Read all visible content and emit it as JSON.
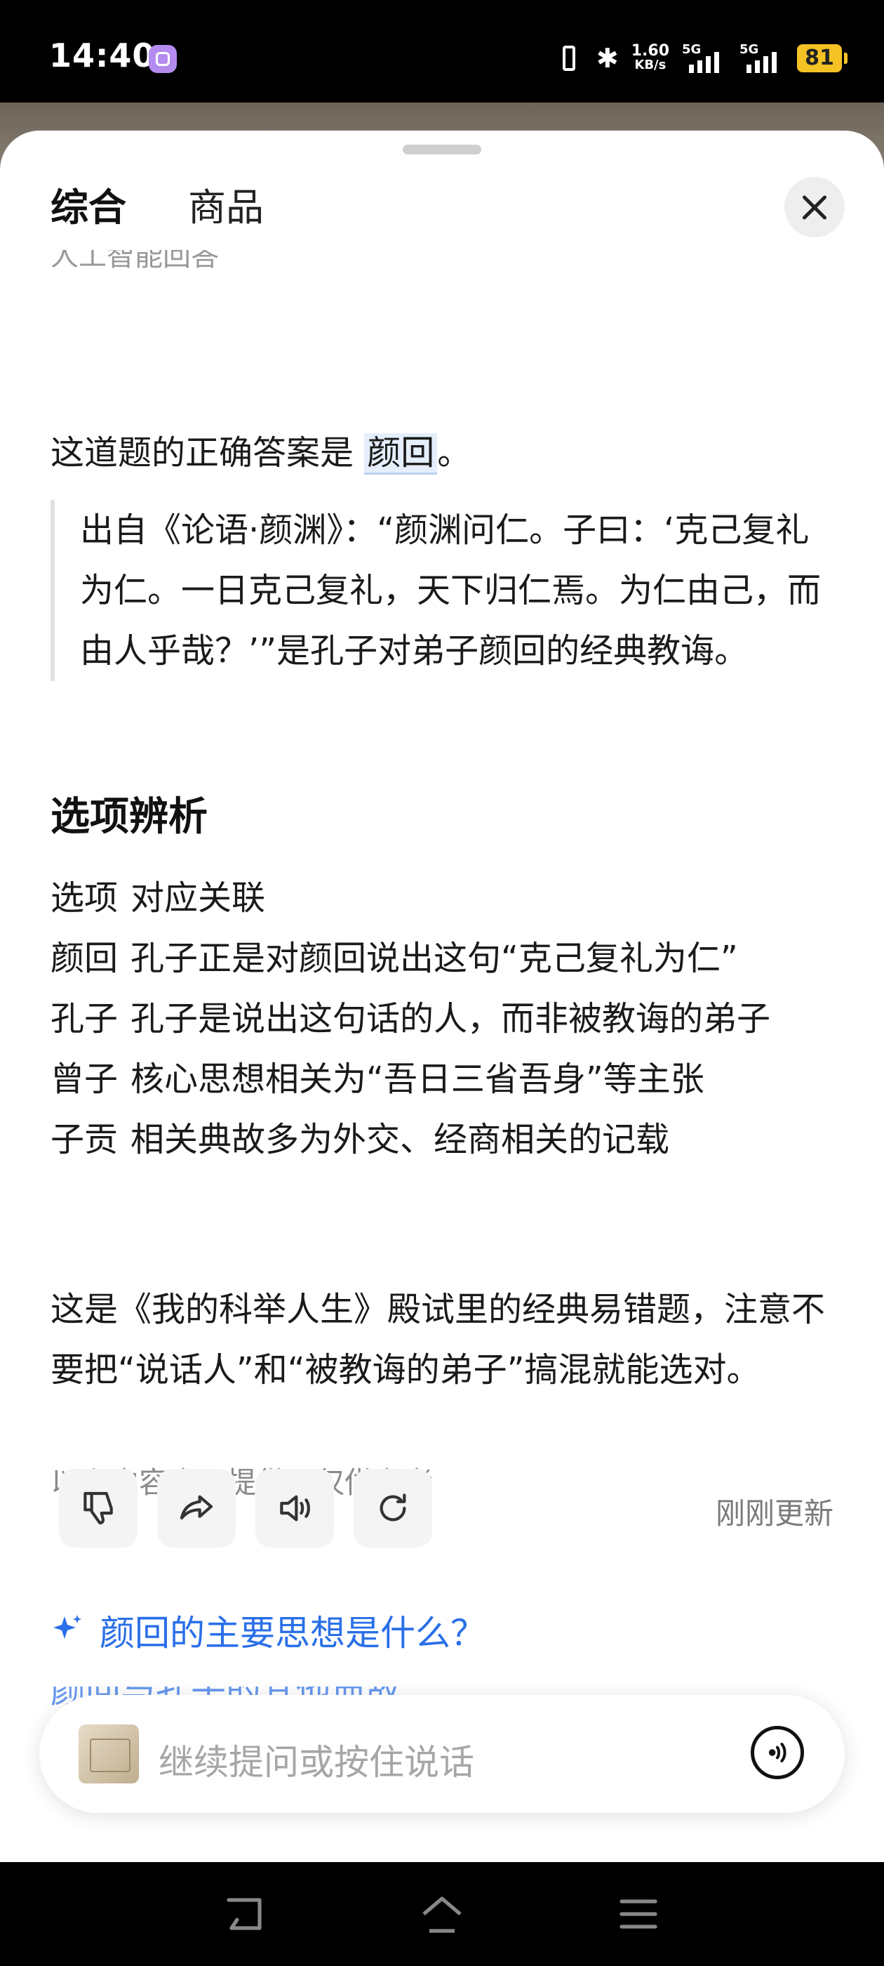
{
  "status_bar": {
    "time": "14:40",
    "net_speed_value": "1.60",
    "net_speed_unit": "KB/s",
    "signal1_label": "5G",
    "signal2_label": "5G",
    "battery": "81"
  },
  "tabs": [
    {
      "label": "综合",
      "active": true
    },
    {
      "label": "商品",
      "active": false
    }
  ],
  "clipped_line": "人工智能回答",
  "answer": {
    "prefix": "这道题的正确答案是 ",
    "highlight": "颜回",
    "suffix": "。"
  },
  "quote": "出自《论语·颜渊》：“颜渊问仁。子曰：‘克己复礼为仁。一日克己复礼，天下归仁焉。为仁由己，而由人乎哉？’”是孔子对弟子颜回的经典教诲。",
  "section_title": "选项辨析",
  "options_table": {
    "header": [
      "选项",
      "对应关联"
    ],
    "rows": [
      [
        "颜回",
        "孔子正是对颜回说出这句“克己复礼为仁”"
      ],
      [
        "孔子",
        "孔子是说出这句话的人，而非被教诲的弟子"
      ],
      [
        "曾子",
        "核心思想相关为“吾日三省吾身”等主张"
      ],
      [
        "子贡",
        "相关典故多为外交、经商相关的记载"
      ]
    ]
  },
  "note": "这是《我的科举人生》殿试里的经典易错题，注意不要把“说话人”和“被教诲的弟子”搞混就能选对。",
  "disclaimer": "以上内容由AI提供，仅供参考",
  "updated": "刚刚更新",
  "suggestion": "颜回的主要思想是什么？",
  "suggestion2": "颜回与孔子的其他典故",
  "input_placeholder": "继续提问或按住说话",
  "accent_color": "#2a6fe8",
  "battery_color": "#f5c224"
}
